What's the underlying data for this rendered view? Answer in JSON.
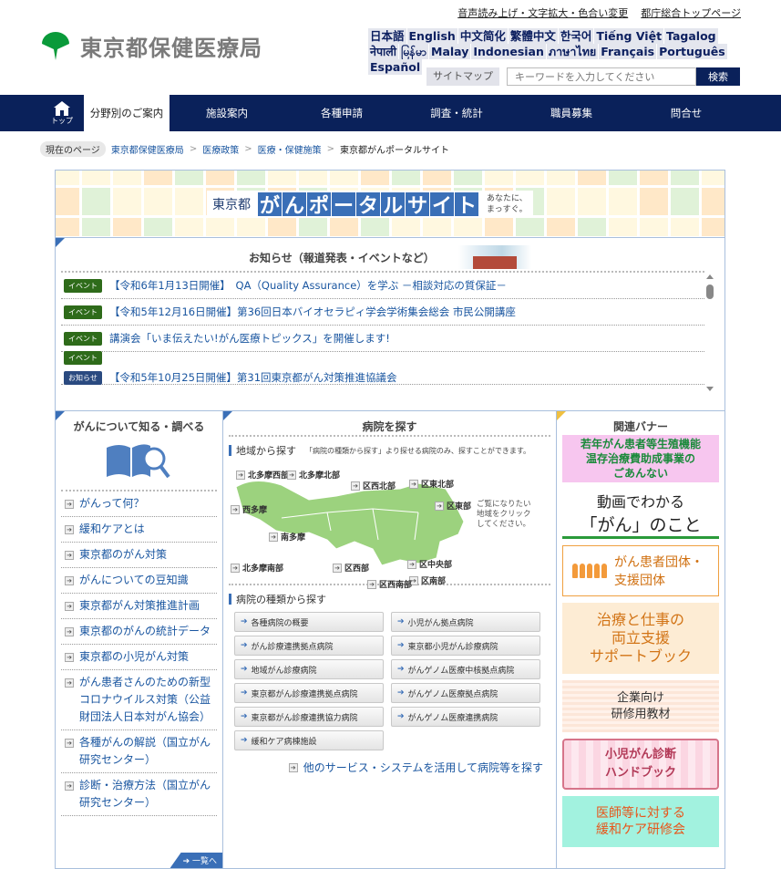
{
  "header": {
    "util_links": [
      "音声読み上げ・文字拡大・色合い変更",
      "都庁総合トップページ"
    ],
    "logo_text": "東京都保健医療局",
    "logo_color": "#0a9a3a",
    "languages": [
      "日本語",
      "English",
      "中文简化",
      "繁體中文",
      "한국어",
      "Tiếng Việt",
      "Tagalog",
      "नेपाली",
      "မြန်မာ",
      "Malay",
      "Indonesian",
      "ภาษาไทย",
      "Français",
      "Português",
      "Español"
    ],
    "sitemap_label": "サイトマップ",
    "search_placeholder": "キーワードを入力してください",
    "search_button": "検索"
  },
  "nav": {
    "home_label": "トップ",
    "items": [
      "分野別のご案内",
      "施設案内",
      "各種申請",
      "調査・統計",
      "職員募集",
      "問合せ"
    ],
    "active_index": 0,
    "bg_color": "#0a215a"
  },
  "breadcrumb": {
    "label": "現在のページ",
    "items": [
      "東京都保健医療局",
      "医療政策",
      "医療・保健施策"
    ],
    "current": "東京都がんポータルサイト"
  },
  "hero": {
    "prefix": "東京都",
    "title_chars": [
      "が",
      "ん",
      "ポ",
      "ー",
      "タ",
      "ル",
      "サ",
      "イ",
      "ト"
    ],
    "tagline_1": "あなたに、",
    "tagline_2": "まっすぐ。"
  },
  "news": {
    "title": "お知らせ（報道発表・イベントなど）",
    "items": [
      {
        "badges": [
          "イベント"
        ],
        "text": "【令和6年1月13日開催】　QA（Quality Assurance）を学ぶ －相談対応の質保証－"
      },
      {
        "badges": [
          "イベント"
        ],
        "text": "【令和5年12月16日開催】第36回日本バイオセラピィ学会学術集会総会 市民公開講座"
      },
      {
        "badges": [
          "イベント"
        ],
        "text": "講演会「いま伝えたい!がん医療トピックス」を開催します!"
      },
      {
        "badges": [
          "イベント",
          "お知らせ"
        ],
        "text": "【令和5年10月25日開催】第31回東京都がん対策推進協議会"
      }
    ]
  },
  "left_column": {
    "title": "がんについて知る・調べる",
    "items": [
      "がんって何？",
      "緩和ケアとは",
      "東京都のがん対策",
      "がんについての豆知識",
      "東京都がん対策推進計画",
      "東京都のがんの統計データ",
      "東京都の小児がん対策",
      "がん患者さんのための新型コロナウイルス対策（公益財団法人日本対がん協会）",
      "各種がんの解説（国立がん研究センター）",
      "診断・治療方法（国立がん研究センター）"
    ],
    "more_label": "一覧へ"
  },
  "middle_column": {
    "title": "病院を探す",
    "region_heading": "地域から探す",
    "region_note": "「病院の種類から探す」より探せる病院のみ、探すことができます。",
    "regions": [
      "北多摩西部",
      "北多摩北部",
      "区西北部",
      "区東北部",
      "西多摩",
      "区東部",
      "南多摩",
      "区中央部",
      "北多摩南部",
      "区西部",
      "区南部",
      "区西南部"
    ],
    "map_hint": [
      "ご覧になりたい",
      "地域をクリック",
      "してください。"
    ],
    "type_heading": "病院の種類から探す",
    "type_buttons": [
      "各種病院の概要",
      "小児がん拠点病院",
      "がん診療連携拠点病院",
      "東京都小児がん診療病院",
      "地域がん診療病院",
      "がんゲノム医療中核拠点病院",
      "東京都がん診療連携拠点病院",
      "がんゲノム医療拠点病院",
      "東京都がん診療連携協力病院",
      "がんゲノム医療連携病院",
      "緩和ケア病棟施設"
    ],
    "other_link": "他のサービス・システムを活用して病院等を探す"
  },
  "right_column": {
    "title": "関連バナー",
    "banners": [
      {
        "lines": [
          "若年がん患者等生殖機能",
          "温存治療費助成事業の",
          "ごあんない"
        ]
      },
      {
        "lines": [
          "動画でわかる",
          "「がん」のこと"
        ]
      },
      {
        "lines": [
          "がん患者団体・",
          "支援団体"
        ]
      },
      {
        "lines": [
          "治療と仕事の",
          "両立支援",
          "サポートブック"
        ]
      },
      {
        "lines": [
          "企業向け",
          "研修用教材"
        ]
      },
      {
        "lines": [
          "小児がん診断",
          "ハンドブック"
        ]
      },
      {
        "lines": [
          "医師等に対する",
          "緩和ケア研修会"
        ]
      }
    ]
  },
  "colors": {
    "accent_blue": "#3a6fb7",
    "event_badge": "#2e6b1a",
    "notice_badge": "#2a4a80",
    "link": "#1a56a0"
  }
}
